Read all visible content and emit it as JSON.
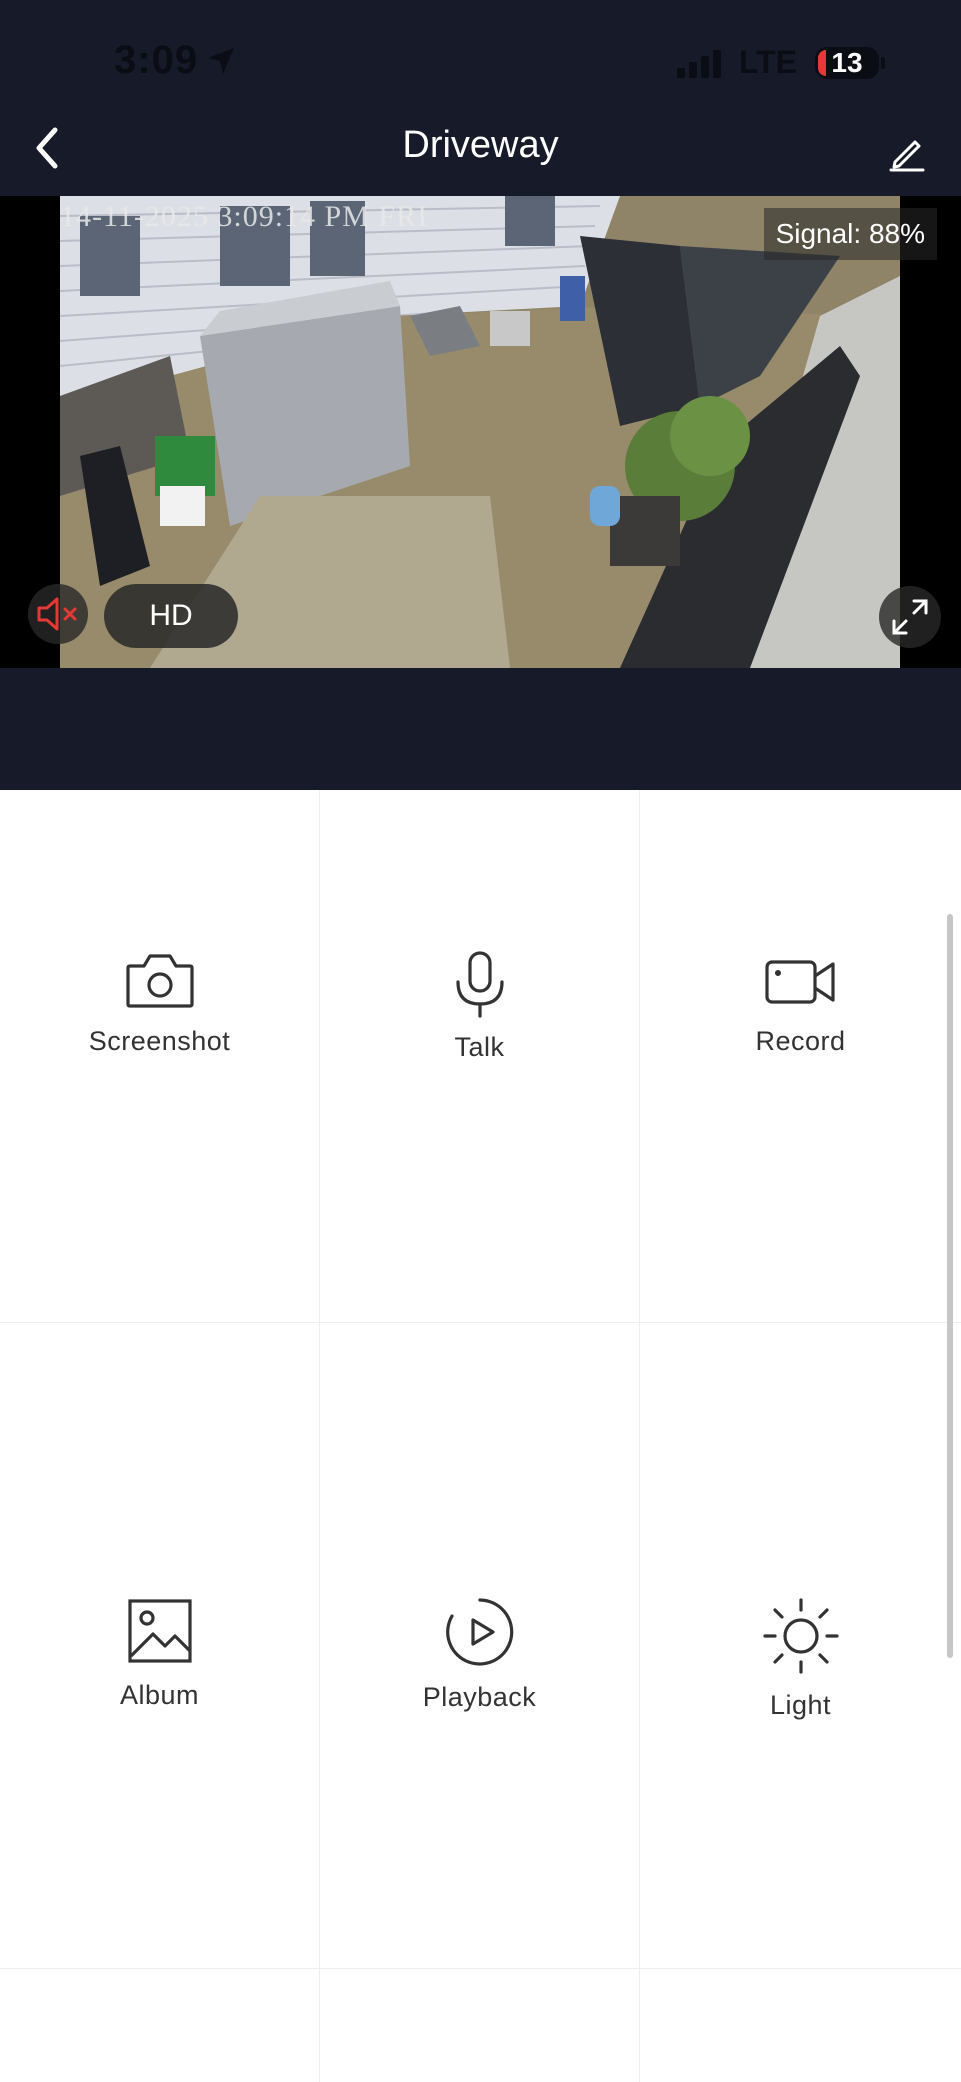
{
  "status_bar": {
    "time": "3:09",
    "network": "LTE",
    "battery": "13"
  },
  "header": {
    "title": "Driveway",
    "back_icon": "chevron-left-icon",
    "edit_icon": "pencil-icon"
  },
  "video": {
    "timestamp_overlay": "14-11-2025 3:09:14 PM FRI",
    "signal_label": "Signal: 88%",
    "quality_label": "HD",
    "mute_icon": "speaker-muted-icon",
    "fullscreen_icon": "expand-icon"
  },
  "controls": [
    {
      "label": "Screenshot",
      "icon": "camera-icon"
    },
    {
      "label": "Talk",
      "icon": "microphone-icon"
    },
    {
      "label": "Record",
      "icon": "video-camera-icon"
    },
    {
      "label": "Album",
      "icon": "image-icon"
    },
    {
      "label": "Playback",
      "icon": "playback-icon"
    },
    {
      "label": "Light",
      "icon": "sun-icon"
    }
  ],
  "colors": {
    "header_bg": "#161a29",
    "mute_red": "#e53935",
    "label": "#333333"
  }
}
